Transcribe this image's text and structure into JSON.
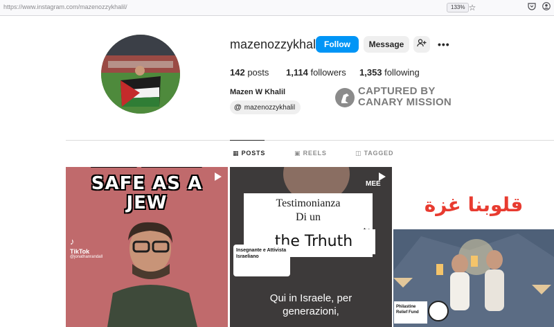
{
  "browser": {
    "url_prefix": "https://www.",
    "url_host": "instagram.com",
    "url_path": "/mazenozzykhalil/",
    "zoom": "133%"
  },
  "profile": {
    "username": "mazenozzykhalil",
    "follow_label": "Follow",
    "message_label": "Message",
    "posts_count": "142",
    "posts_label": "posts",
    "followers_count": "1,114",
    "followers_label": "followers",
    "following_count": "1,353",
    "following_label": "following",
    "full_name": "Mazen W Khalil",
    "threads_handle": "mazenozzykhalil"
  },
  "watermark": {
    "line1": "CAPTURED BY",
    "line2": "CANARY MISSION"
  },
  "tabs": [
    {
      "label": "POSTS",
      "icon": "grid-icon",
      "active": true
    },
    {
      "label": "REELS",
      "icon": "reels-icon",
      "active": false
    },
    {
      "label": "TAGGED",
      "icon": "tagged-icon",
      "active": false
    }
  ],
  "posts": {
    "post1": {
      "line1": "SAFE AS A",
      "line2": "JEW",
      "tiktok_name": "TikTok",
      "tiktok_handle": "@jonathanrandall"
    },
    "post2": {
      "line1": "Testimonianza",
      "line2": "Di un",
      "line3": "te",
      "highlight": "the Trhuth",
      "label_line1": "Insegnante e Attivista",
      "label_line2": "Israeliano",
      "sub1": "Qui in Israele, per",
      "sub2": "generazioni,",
      "logo": "MEE"
    },
    "post3": {
      "arabic": "قلوبنا غزة",
      "fund_line1": "Philastine",
      "fund_line2": "Relief Fund"
    }
  },
  "colors": {
    "follow_button": "#0095f6",
    "post3_title": "#e83b30"
  }
}
